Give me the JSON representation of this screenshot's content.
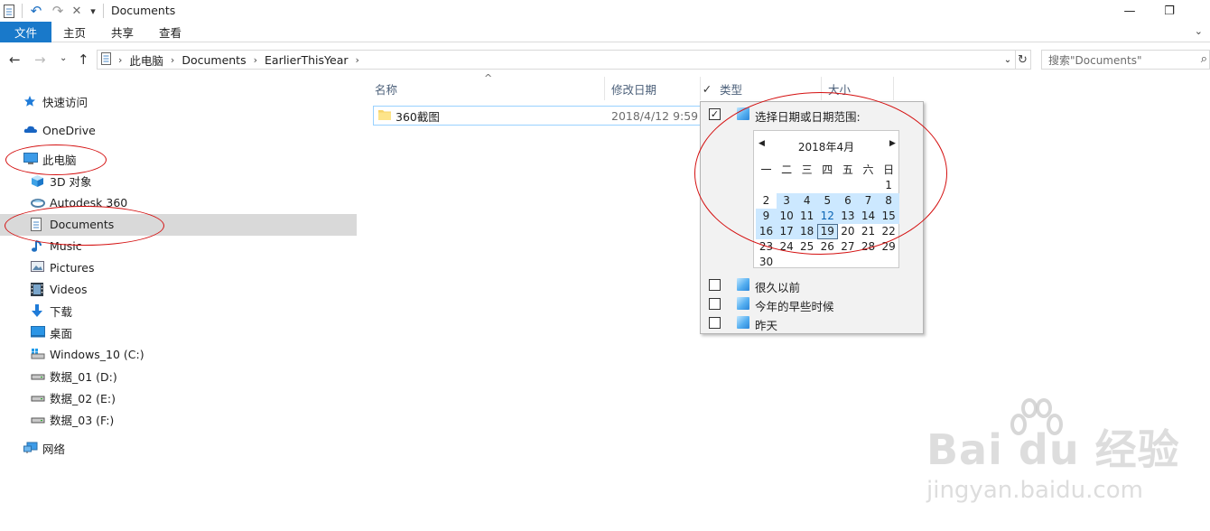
{
  "window": {
    "title": "Documents",
    "qa_undo": "↶",
    "qa_redo": "↷",
    "qa_delete": "✕",
    "qa_customize": "▾",
    "minimize": "—",
    "restore": "❐"
  },
  "ribbon": {
    "tabs": [
      "文件",
      "主页",
      "共享",
      "查看"
    ],
    "collapse": "⌄"
  },
  "address": {
    "back": "←",
    "forward": "→",
    "recent": "⌄",
    "up": "↑",
    "crumbs": [
      "此电脑",
      "Documents",
      "EarlierThisYear"
    ],
    "sep": "›",
    "dropdown": "⌄",
    "refresh": "↻"
  },
  "search": {
    "placeholder": "搜索\"Documents\"",
    "icon": "⌕"
  },
  "nav": {
    "items": [
      {
        "label": "快速访问",
        "icon": "star-icon"
      },
      {
        "label": "OneDrive",
        "icon": "cloud-icon"
      },
      {
        "label": "此电脑",
        "icon": "computer-icon"
      },
      {
        "label": "3D 对象",
        "icon": "cube-icon"
      },
      {
        "label": "Autodesk 360",
        "icon": "autodesk-icon"
      },
      {
        "label": "Documents",
        "icon": "document-icon"
      },
      {
        "label": "Music",
        "icon": "music-icon"
      },
      {
        "label": "Pictures",
        "icon": "pictures-icon"
      },
      {
        "label": "Videos",
        "icon": "videos-icon"
      },
      {
        "label": "下载",
        "icon": "download-icon"
      },
      {
        "label": "桌面",
        "icon": "desktop-icon"
      },
      {
        "label": "Windows_10 (C:)",
        "icon": "windows-drive-icon"
      },
      {
        "label": "数据_01 (D:)",
        "icon": "drive-icon"
      },
      {
        "label": "数据_02 (E:)",
        "icon": "drive-icon"
      },
      {
        "label": "数据_03 (F:)",
        "icon": "drive-icon"
      },
      {
        "label": "网络",
        "icon": "network-icon"
      }
    ]
  },
  "columns": {
    "name": "名称",
    "date": "修改日期",
    "type": "类型",
    "size": "大小",
    "check": "✓",
    "sort": "^"
  },
  "files": [
    {
      "name": "360截图",
      "date": "2018/4/12 9:59",
      "icon": "folder-icon"
    }
  ],
  "filter": {
    "range_label": "选择日期或日期范围:",
    "range_checked": "✓",
    "calendar": {
      "month": "2018年4月",
      "prev": "◀",
      "next": "▶",
      "weekdays": [
        "一",
        "二",
        "三",
        "四",
        "五",
        "六",
        "日"
      ],
      "today": 12,
      "selected": 19
    },
    "options": [
      "很久以前",
      "今年的早些时候",
      "昨天"
    ]
  },
  "watermark": {
    "brand": "Bai du 经验",
    "url": "jingyan.baidu.com"
  }
}
